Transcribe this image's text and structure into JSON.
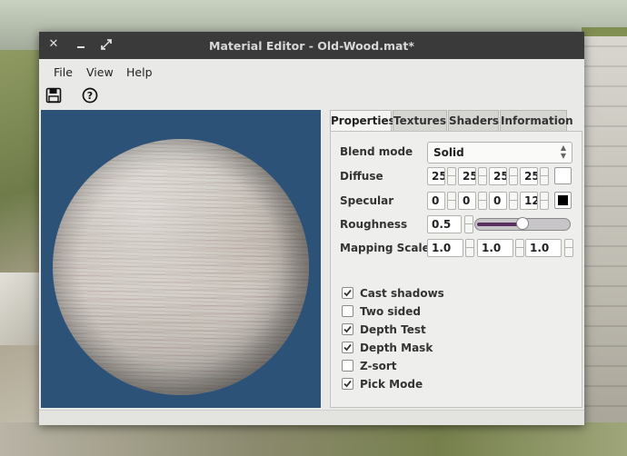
{
  "window": {
    "title": "Material Editor - Old-Wood.mat*",
    "controls": [
      "close-icon",
      "minimize-icon",
      "maximize-icon"
    ]
  },
  "menubar": {
    "file": "File",
    "view": "View",
    "help": "Help"
  },
  "toolbar": {
    "icons": [
      "save-icon",
      "help-icon"
    ]
  },
  "tabs": [
    {
      "label": "Properties",
      "active": true
    },
    {
      "label": "Textures",
      "active": false
    },
    {
      "label": "Shaders",
      "active": false
    },
    {
      "label": "Information",
      "active": false
    }
  ],
  "properties": {
    "blend_mode": {
      "label": "Blend mode",
      "value": "Solid"
    },
    "diffuse": {
      "label": "Diffuse",
      "values": [
        "25",
        "25",
        "25",
        "25"
      ],
      "color": "#ffffff"
    },
    "specular": {
      "label": "Specular",
      "values": [
        "0",
        "0",
        "0",
        "12"
      ],
      "color": "#000000"
    },
    "roughness": {
      "label": "Roughness",
      "value": "0.5",
      "slider_fraction": 0.5
    },
    "mapping_scale": {
      "label": "Mapping Scale",
      "values": [
        "1.0",
        "1.0",
        "1.0"
      ]
    }
  },
  "flags": [
    {
      "label": "Cast shadows",
      "checked": true
    },
    {
      "label": "Two sided",
      "checked": false
    },
    {
      "label": "Depth Test",
      "checked": true
    },
    {
      "label": "Depth Mask",
      "checked": true
    },
    {
      "label": "Z-sort",
      "checked": false
    },
    {
      "label": "Pick Mode",
      "checked": true
    }
  ],
  "colors": {
    "viewport_bg": "#2d5278",
    "titlebar_bg": "#3a3a3a",
    "slider_accent": "#5a2e60"
  }
}
